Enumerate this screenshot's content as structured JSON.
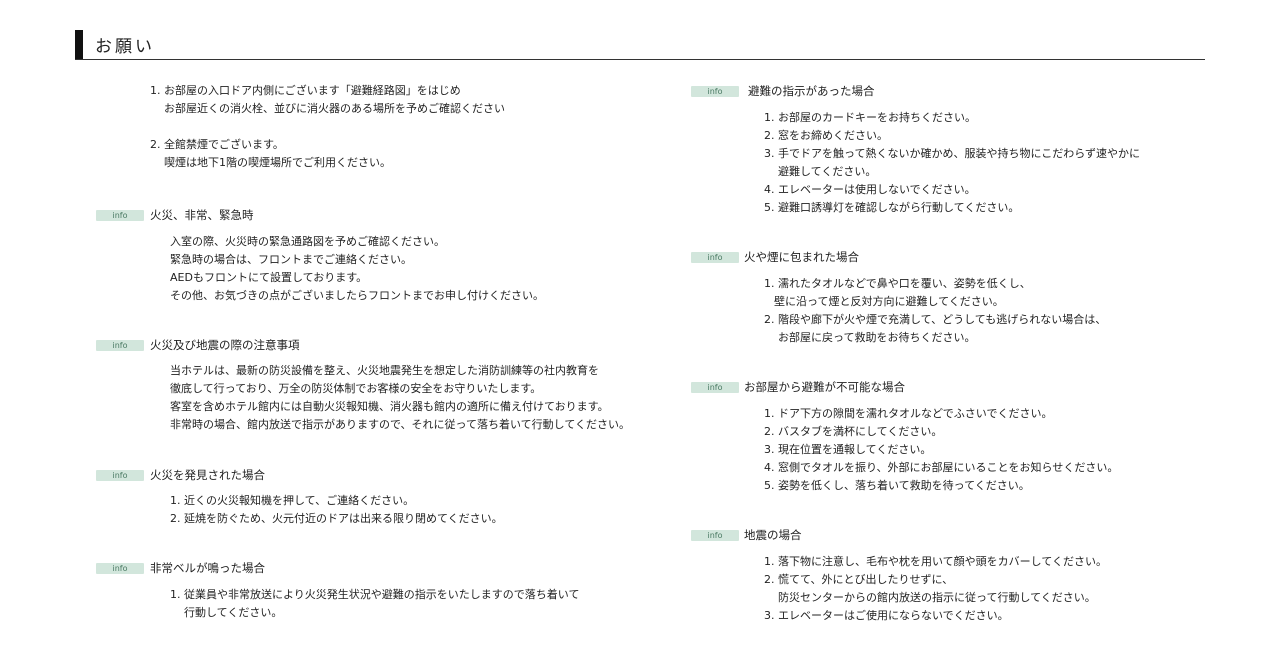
{
  "title": "お願い",
  "badge_label": "info",
  "intro": {
    "item1_num": "1.",
    "item1_line1": "お部屋の入口ドア内側にございます「避難経路図」をはじめ",
    "item1_line2": "お部屋近くの消火栓、並びに消火器のある場所を予めご確認ください",
    "item2_num": "2.",
    "item2_line1": "全館禁煙でございます。",
    "item2_line2": "喫煙は地下1階の喫煙場所でご利用ください。"
  },
  "sections": {
    "emergency": {
      "title": "火災、非常、緊急時",
      "lines": [
        "入室の際、火災時の緊急通路図を予めご確認ください。",
        "緊急時の場合は、フロントまでご連絡ください。",
        "AEDもフロントにて設置しております。",
        "その他、お気づきの点がございましたらフロントまでお申し付けください。"
      ]
    },
    "earthquake_notes": {
      "title": "火災及び地震の際の注意事項",
      "lines": [
        "当ホテルは、最新の防災設備を整え、火災地震発生を想定した消防訓練等の社内教育を",
        "徹底して行っており、万全の防災体制でお客様の安全をお守りいたします。",
        "客室を含めホテル館内には自動火災報知機、消火器も館内の適所に備え付けております。",
        "非常時の場合、館内放送で指示がありますので、それに従って落ち着いて行動してください。"
      ]
    },
    "fire_found": {
      "title": "火災を発見された場合",
      "items": [
        "近くの火災報知機を押して、ご連絡ください。",
        "延焼を防ぐため、火元付近のドアは出来る限り閉めてください。"
      ]
    },
    "bell": {
      "title": "非常ベルが鳴った場合",
      "item_line1": "従業員や非常放送により火災発生状況や避難の指示をいたしますので落ち着いて",
      "item_line2": "行動してください。"
    },
    "evacuation": {
      "title": "避難の指示があった場合",
      "item1": "お部屋のカードキーをお持ちください。",
      "item2": "窓をお締めください。",
      "item3_line1": "手でドアを触って熱くないか確かめ、服装や持ち物にこだわらず速やかに",
      "item3_line2": "避難してください。",
      "item4": "エレベーターは使用しないでください。",
      "item5": "避難口誘導灯を確認しながら行動してください。"
    },
    "smoke": {
      "title": "火や煙に包まれた場合",
      "item1_line1": "濡れたタオルなどで鼻や口を覆い、姿勢を低くし、",
      "item1_line2": "壁に沿って煙と反対方向に避難してください。",
      "item2_line1": "階段や廊下が火や煙で充満して、どうしても逃げられない場合は、",
      "item2_line2": "お部屋に戻って救助をお待ちください。"
    },
    "cannot_evacuate": {
      "title": "お部屋から避難が不可能な場合",
      "items": [
        "ドア下方の隙間を濡れタオルなどでふさいでください。",
        "バスタブを満杯にしてください。",
        "現在位置を通報してください。",
        "窓側でタオルを振り、外部にお部屋にいることをお知らせください。",
        "姿勢を低くし、落ち着いて救助を待ってください。"
      ]
    },
    "quake": {
      "title": "地震の場合",
      "item1": "落下物に注意し、毛布や枕を用いて顔や頭をカバーしてください。",
      "item2_line1": "慌てて、外にとび出したりせずに、",
      "item2_line2": "防災センターからの館内放送の指示に従って行動してください。",
      "item3": "エレベーターはご使用にならないでください。"
    }
  },
  "nums": [
    "1.",
    "2.",
    "3.",
    "4.",
    "5."
  ],
  "colors": {
    "badge_bg": "#d2e6dc",
    "badge_text": "#4a7a63",
    "title_bar": "#111111"
  }
}
